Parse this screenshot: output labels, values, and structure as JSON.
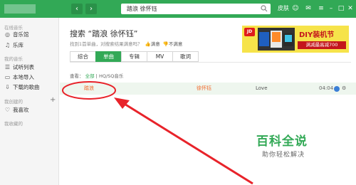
{
  "topbar": {
    "search_value": "踏浪 徐怀钰",
    "labels": [
      "皮肤"
    ],
    "icons": [
      "back-icon",
      "forward-icon",
      "search-icon",
      "user-icon",
      "mail-icon",
      "settings-icon",
      "minimize-icon",
      "maximize-icon",
      "close-icon"
    ]
  },
  "sidebar": {
    "section_online": "在线音乐",
    "music_hall": "音乐馆",
    "library": "乐库",
    "section_mine": "我的音乐",
    "trial_list": "试听列表",
    "local_import": "本地导入",
    "downloaded": "下载的歌曲",
    "section_created": "我创建的",
    "my_fav": "我喜欢",
    "section_collected": "我收藏的"
  },
  "main": {
    "title": "搜索 “踏浪 徐怀钰”",
    "subtitle": "找到1首单曲，对搜索结果满意吗？",
    "fb_yes": "满意",
    "fb_no": "不满意",
    "tabs": [
      "综合",
      "单曲",
      "专辑",
      "MV",
      "歌词"
    ],
    "active_tab": "单曲",
    "filter_prefix": "查看：",
    "filter_all": "全部",
    "filter_sep": "|",
    "filter_hq": "HQ/SQ音乐",
    "result": {
      "song": "踏浪",
      "artist": "徐怀钰",
      "album": "Love",
      "duration": "04:04"
    }
  },
  "ad": {
    "jd": "JD",
    "title": "DIY装机节",
    "sub": "满减最高减700"
  },
  "watermark": {
    "line1": "百科全说",
    "line2": "助你轻松解决"
  },
  "colors": {
    "accent": "#32a956",
    "annotation": "#e8232a",
    "result_text": "#f26b2e"
  }
}
